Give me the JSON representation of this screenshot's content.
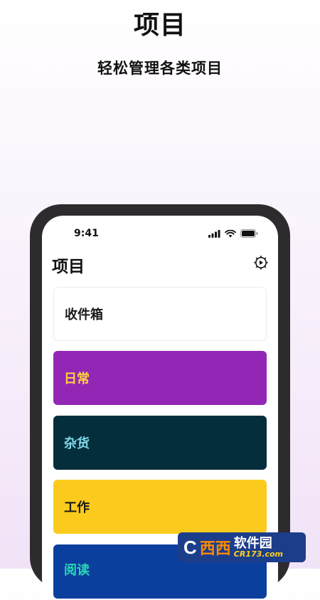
{
  "promo": {
    "headline": "项目",
    "subheadline": "轻松管理各类项目"
  },
  "status_bar": {
    "time": "9:41",
    "icons": [
      "signal-icon",
      "wifi-icon",
      "battery-icon"
    ]
  },
  "nav": {
    "title": "项目",
    "settings_icon": "gear-icon"
  },
  "projects": [
    {
      "label": "收件箱",
      "bg": "#ffffff",
      "fg": "#1a1a1a"
    },
    {
      "label": "日常",
      "bg": "#9327b5",
      "fg": "#ffd43b"
    },
    {
      "label": "杂货",
      "bg": "#052e3c",
      "fg": "#7fd6e4"
    },
    {
      "label": "工作",
      "bg": "#facb1d",
      "fg": "#1a1a1a"
    },
    {
      "label": "阅读",
      "bg": "#0b3f9e",
      "fg": "#2bd6b4"
    }
  ],
  "watermark": {
    "brand": "软件园",
    "prefix": "西西",
    "url": "CR173.com"
  }
}
